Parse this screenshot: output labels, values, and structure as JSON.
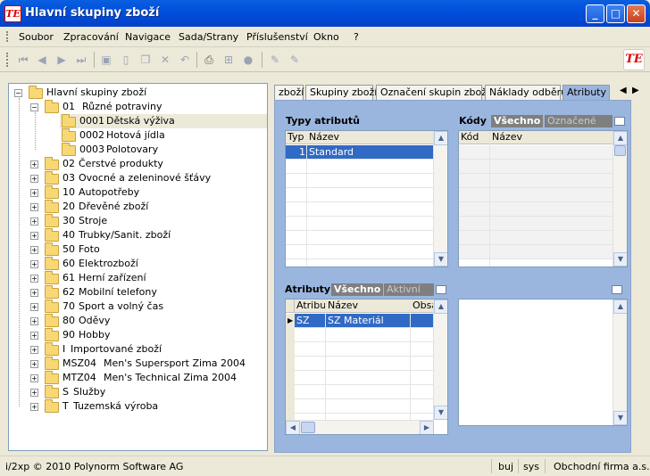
{
  "window": {
    "title": "Hlavní skupiny zboží",
    "app_icon": "TE",
    "controls": {
      "minimize": "_",
      "maximize": "□",
      "close": "✕"
    }
  },
  "menu": [
    "Soubor",
    "Zpracování",
    "Navigace",
    "Sada/Strany",
    "Příslušenství",
    "Okno",
    "?"
  ],
  "toolbar": {
    "icons": [
      "first-icon",
      "prev-icon",
      "next-icon",
      "last-icon",
      "save-icon",
      "new-icon",
      "copy-icon",
      "delete-icon",
      "undo-icon",
      "print-icon",
      "tree-icon",
      "refresh-icon",
      "edit-icon",
      "edit2-icon"
    ],
    "brand": "TE"
  },
  "tree": {
    "root": "Hlavní skupiny zboží",
    "items": [
      {
        "code": "01",
        "name": "Různé potraviny",
        "expanded": true
      },
      {
        "code": "0001",
        "name": "Dětská výživa",
        "child": true,
        "selected": true
      },
      {
        "code": "0002",
        "name": "Hotová jídla",
        "child": true
      },
      {
        "code": "0003",
        "name": "Polotovary",
        "child": true
      },
      {
        "code": "02",
        "name": "Čerstvé produkty"
      },
      {
        "code": "03",
        "name": "Ovocné a zeleninové šťávy"
      },
      {
        "code": "10",
        "name": "Autopotřeby"
      },
      {
        "code": "20",
        "name": "Dřevěné zboží"
      },
      {
        "code": "30",
        "name": "Stroje"
      },
      {
        "code": "40",
        "name": "Trubky/Sanit. zboží"
      },
      {
        "code": "50",
        "name": "Foto"
      },
      {
        "code": "60",
        "name": "Elektrozboží"
      },
      {
        "code": "61",
        "name": "Herní zařízení"
      },
      {
        "code": "62",
        "name": "Mobilní telefony"
      },
      {
        "code": "70",
        "name": "Sport a volný čas"
      },
      {
        "code": "80",
        "name": "Oděvy"
      },
      {
        "code": "90",
        "name": "Hobby"
      },
      {
        "code": "I",
        "name": "Importované zboží"
      },
      {
        "code": "MSZ04",
        "name": "Men's Supersport Zima 2004"
      },
      {
        "code": "MTZ04",
        "name": "Men's Technical Zima 2004"
      },
      {
        "code": "S",
        "name": "Služby"
      },
      {
        "code": "T",
        "name": "Tuzemská výroba"
      }
    ]
  },
  "tabs": [
    "zboží",
    "Skupiny zboží",
    "Označení skupin zboží",
    "Náklady odběru",
    "Atributy"
  ],
  "active_tab": "Atributy",
  "typy_atributu": {
    "label": "Typy atributů",
    "columns": [
      "Typ",
      "Název"
    ],
    "rows": [
      {
        "typ": "1",
        "nazev": "Standard"
      }
    ]
  },
  "kody": {
    "label": "Kódy",
    "filter_all": "Všechno",
    "filter_marked": "Označené",
    "columns": [
      "Kód",
      "Název"
    ]
  },
  "atributy": {
    "label": "Atributy",
    "filter_all": "Všechno",
    "filter_active": "Aktivní",
    "columns": [
      "Atribut",
      "Název",
      "Obsa"
    ],
    "rows": [
      {
        "atribut": "SZ",
        "nazev": "SZ Materiál",
        "obsah": ""
      }
    ]
  },
  "status": {
    "copyright": "i/2xp © 2010 Polynorm Software AG",
    "user": "buj",
    "db": "sys",
    "company": "Obchodní firma a.s."
  }
}
